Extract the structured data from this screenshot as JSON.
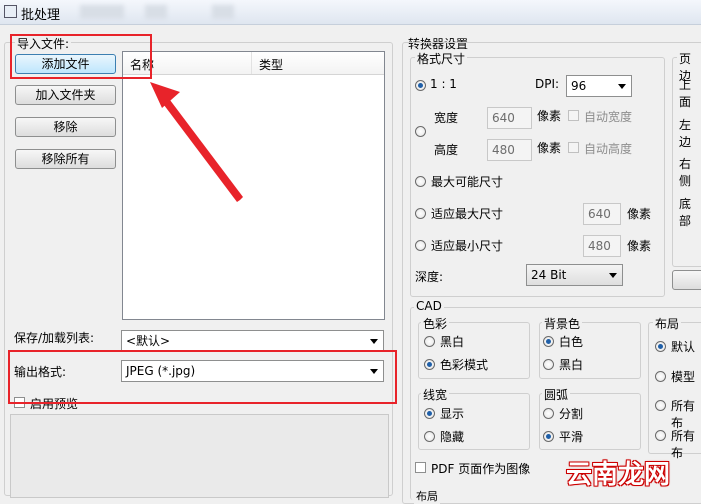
{
  "window": {
    "title": "批处理"
  },
  "import": {
    "group_label": "导入文件:",
    "buttons": {
      "add_file": "添加文件",
      "add_folder": "加入文件夹",
      "remove": "移除",
      "remove_all": "移除所有"
    },
    "columns": [
      "名称",
      "类型"
    ],
    "save_load_label": "保存/加载列表:",
    "save_load_value": "<默认>",
    "output_format_label": "输出格式:",
    "output_format_value": "JPEG (*.jpg)",
    "preview_label": "启用预览",
    "preview_checked": false
  },
  "converter": {
    "group_label": "转换器设置",
    "format_size": {
      "label": "格式尺寸",
      "one_to_one": "1 : 1",
      "dpi_label": "DPI:",
      "dpi_value": "96",
      "width_label": "宽度",
      "width_value": "640",
      "height_label": "高度",
      "height_value": "480",
      "unit": "像素",
      "auto_width": "自动宽度",
      "auto_height": "自动高度",
      "max_possible": "最大可能尺寸",
      "fit_max": "适应最大尺寸",
      "fit_max_value": "640",
      "fit_min": "适应最小尺寸",
      "fit_min_value": "480",
      "depth_label": "深度:",
      "depth_value": "24 Bit"
    },
    "margins": {
      "label": "页边",
      "top": "上面",
      "left": "左边",
      "right": "右侧",
      "bottom": "底部"
    },
    "cad": {
      "label": "CAD",
      "color": {
        "label": "色彩",
        "options": [
          "黑白",
          "色彩模式"
        ],
        "selected": 1
      },
      "background": {
        "label": "背景色",
        "options": [
          "白色",
          "黑白"
        ],
        "selected": 0
      },
      "layout": {
        "label": "布局",
        "options": [
          "默认",
          "模型",
          "所有布",
          "所有布"
        ],
        "selected": 0
      },
      "line_width": {
        "label": "线宽",
        "options": [
          "显示",
          "隐藏"
        ],
        "selected": 0
      },
      "arc": {
        "label": "圆弧",
        "options": [
          "分割",
          "平滑"
        ],
        "selected": 1
      },
      "pdf_as_image": "PDF 页面作为图像",
      "layout_bottom": "布局"
    }
  },
  "watermark": "云南龙网"
}
